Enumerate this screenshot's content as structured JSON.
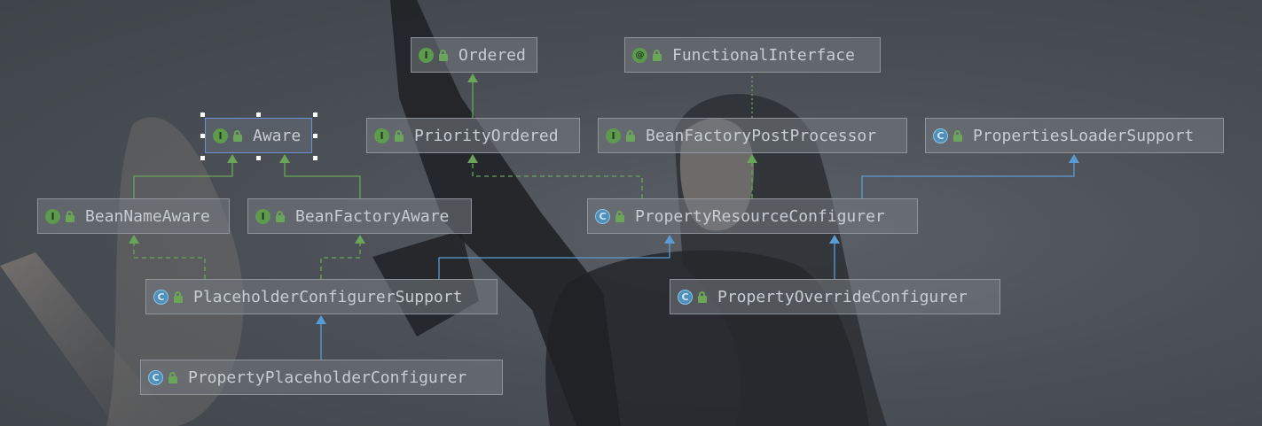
{
  "diagram": {
    "nodes": [
      {
        "id": "ordered",
        "label": "Ordered",
        "kind": "I",
        "kind_symbol": "I"
      },
      {
        "id": "functional_interface",
        "label": "FunctionalInterface",
        "kind": "@",
        "kind_symbol": "@"
      },
      {
        "id": "aware",
        "label": "Aware",
        "kind": "I",
        "kind_symbol": "I"
      },
      {
        "id": "priority_ordered",
        "label": "PriorityOrdered",
        "kind": "I",
        "kind_symbol": "I"
      },
      {
        "id": "bean_factory_post_processor",
        "label": "BeanFactoryPostProcessor",
        "kind": "I",
        "kind_symbol": "I"
      },
      {
        "id": "properties_loader_support",
        "label": "PropertiesLoaderSupport",
        "kind": "C",
        "kind_symbol": "C"
      },
      {
        "id": "bean_name_aware",
        "label": "BeanNameAware",
        "kind": "I",
        "kind_symbol": "I"
      },
      {
        "id": "bean_factory_aware",
        "label": "BeanFactoryAware",
        "kind": "I",
        "kind_symbol": "I"
      },
      {
        "id": "property_resource_configurer",
        "label": "PropertyResourceConfigurer",
        "kind": "C",
        "kind_symbol": "C"
      },
      {
        "id": "placeholder_configurer_support",
        "label": "PlaceholderConfigurerSupport",
        "kind": "C",
        "kind_symbol": "C"
      },
      {
        "id": "property_override_configurer",
        "label": "PropertyOverrideConfigurer",
        "kind": "C",
        "kind_symbol": "C"
      },
      {
        "id": "property_placeholder_configurer",
        "label": "PropertyPlaceholderConfigurer",
        "kind": "C",
        "kind_symbol": "C"
      }
    ],
    "edges": [
      {
        "from": "priority_ordered",
        "to": "ordered",
        "type": "interface-extends"
      },
      {
        "from": "bean_name_aware",
        "to": "aware",
        "type": "interface-extends"
      },
      {
        "from": "bean_factory_aware",
        "to": "aware",
        "type": "interface-extends"
      },
      {
        "from": "bean_factory_post_processor",
        "to": "functional_interface",
        "type": "annotated-with"
      },
      {
        "from": "property_resource_configurer",
        "to": "priority_ordered",
        "type": "implements"
      },
      {
        "from": "property_resource_configurer",
        "to": "bean_factory_post_processor",
        "type": "implements"
      },
      {
        "from": "property_resource_configurer",
        "to": "properties_loader_support",
        "type": "extends"
      },
      {
        "from": "placeholder_configurer_support",
        "to": "bean_name_aware",
        "type": "implements"
      },
      {
        "from": "placeholder_configurer_support",
        "to": "bean_factory_aware",
        "type": "implements"
      },
      {
        "from": "placeholder_configurer_support",
        "to": "property_resource_configurer",
        "type": "extends"
      },
      {
        "from": "property_override_configurer",
        "to": "property_resource_configurer",
        "type": "extends"
      },
      {
        "from": "property_placeholder_configurer",
        "to": "placeholder_configurer_support",
        "type": "extends"
      }
    ],
    "selected_node": "aware"
  },
  "colors": {
    "interface_edge": "#6aa55a",
    "class_edge": "#5b9bd5",
    "annotation_edge": "#6aa55a",
    "selection": "#6d8fd8"
  }
}
